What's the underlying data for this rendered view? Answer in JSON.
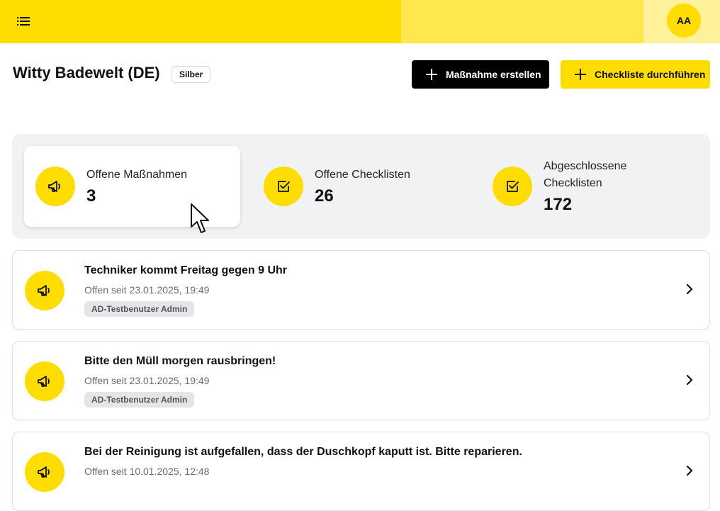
{
  "topbar": {
    "menu_icon": "menu-icon",
    "avatar_initials": "AA",
    "colors": [
      "#FFDD00",
      "#FFE84D",
      "#FFF29A"
    ]
  },
  "header": {
    "title": "Witty Badewelt (DE)",
    "badge": "Silber",
    "create_measure_label": "Maßnahme erstellen",
    "run_checklist_label": "Checkliste durchführen"
  },
  "stats": [
    {
      "label": "Offene Maßnahmen",
      "value": "3",
      "icon": "megaphone-icon",
      "active": true
    },
    {
      "label": "Offene Checklisten",
      "value": "26",
      "icon": "checkbox-icon",
      "active": false
    },
    {
      "label_line1": "Abgeschlossene",
      "label_line2": "Checklisten",
      "value": "172",
      "icon": "checkbox-icon",
      "active": false
    }
  ],
  "items": [
    {
      "title": "Techniker kommt Freitag gegen 9 Uhr",
      "subtitle": "Offen seit 23.01.2025, 19:49",
      "tag": "AD-Testbenutzer Admin"
    },
    {
      "title": "Bitte den Müll morgen rausbringen!",
      "subtitle": "Offen seit 23.01.2025, 19:49",
      "tag": "AD-Testbenutzer Admin"
    },
    {
      "title": "Bei der Reinigung ist aufgefallen, dass der Duschkopf kaputt ist. Bitte reparieren.",
      "subtitle": "Offen seit 10.01.2025, 12:48",
      "tag": ""
    }
  ],
  "colors": {
    "accent": "#FFDD00",
    "dark": "#000000",
    "panel": "#F1F2F4"
  }
}
